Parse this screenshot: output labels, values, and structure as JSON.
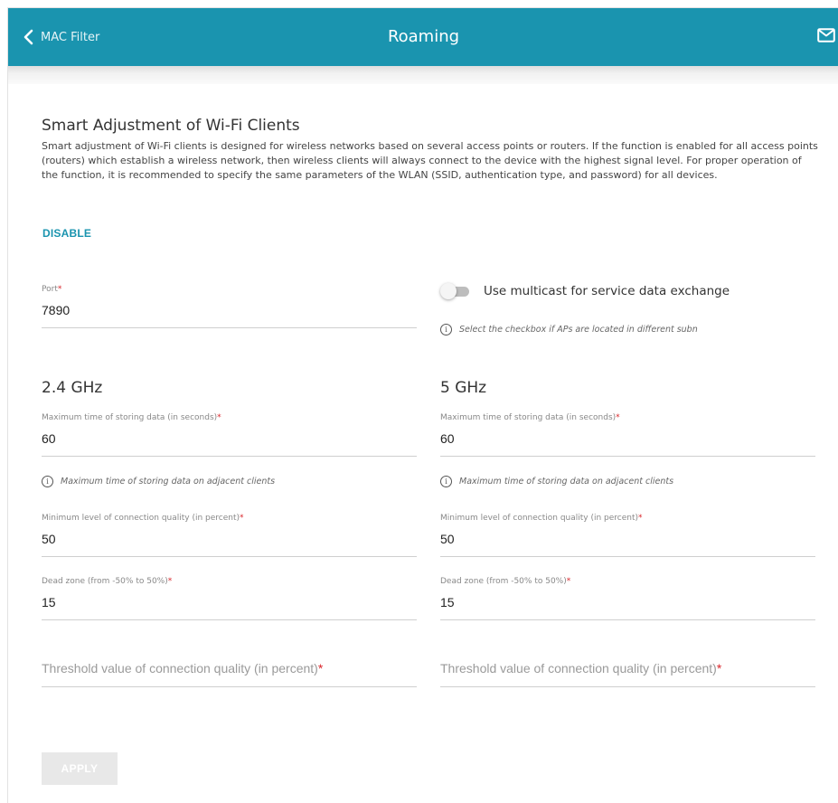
{
  "header": {
    "back_label": "MAC Filter",
    "title": "Roaming"
  },
  "section": {
    "title": "Smart Adjustment of Wi-Fi Clients",
    "description": "Smart adjustment of Wi-Fi clients is designed for wireless networks based on several access points or routers. If the function is enabled for all access points (routers) which establish a wireless network, then wireless clients will always connect to the device with the highest signal level. For proper operation of the function, it is recommended to specify the same parameters of the WLAN (SSID, authentication type, and password) for all devices.",
    "disable_label": "DISABLE"
  },
  "port": {
    "label": "Port",
    "value": "7890"
  },
  "multicast": {
    "label": "Use multicast for service data exchange",
    "enabled": false,
    "hint": "Select the checkbox if APs are located in different subn"
  },
  "band_24": {
    "title": "2.4 GHz",
    "max_time_label": "Maximum time of storing data (in seconds)",
    "max_time_value": "60",
    "max_time_hint": "Maximum time of storing data on adjacent clients",
    "min_quality_label": "Minimum level of connection quality (in percent)",
    "min_quality_value": "50",
    "dead_zone_label": "Dead zone (from -50% to 50%)",
    "dead_zone_value": "15",
    "threshold_placeholder": "Threshold value of connection quality (in percent)"
  },
  "band_5": {
    "title": "5 GHz",
    "max_time_label": "Maximum time of storing data (in seconds)",
    "max_time_value": "60",
    "max_time_hint": "Maximum time of storing data on adjacent clients",
    "min_quality_label": "Minimum level of connection quality (in percent)",
    "min_quality_value": "50",
    "dead_zone_label": "Dead zone (from -50% to 50%)",
    "dead_zone_value": "15",
    "threshold_placeholder": "Threshold value of connection quality (in percent)"
  },
  "required_mark": "*",
  "info_glyph": "i",
  "apply_label": "APPLY",
  "colors": {
    "accent": "#1a94af",
    "required": "#d9262b",
    "button_disabled": "#e8e8e8"
  }
}
